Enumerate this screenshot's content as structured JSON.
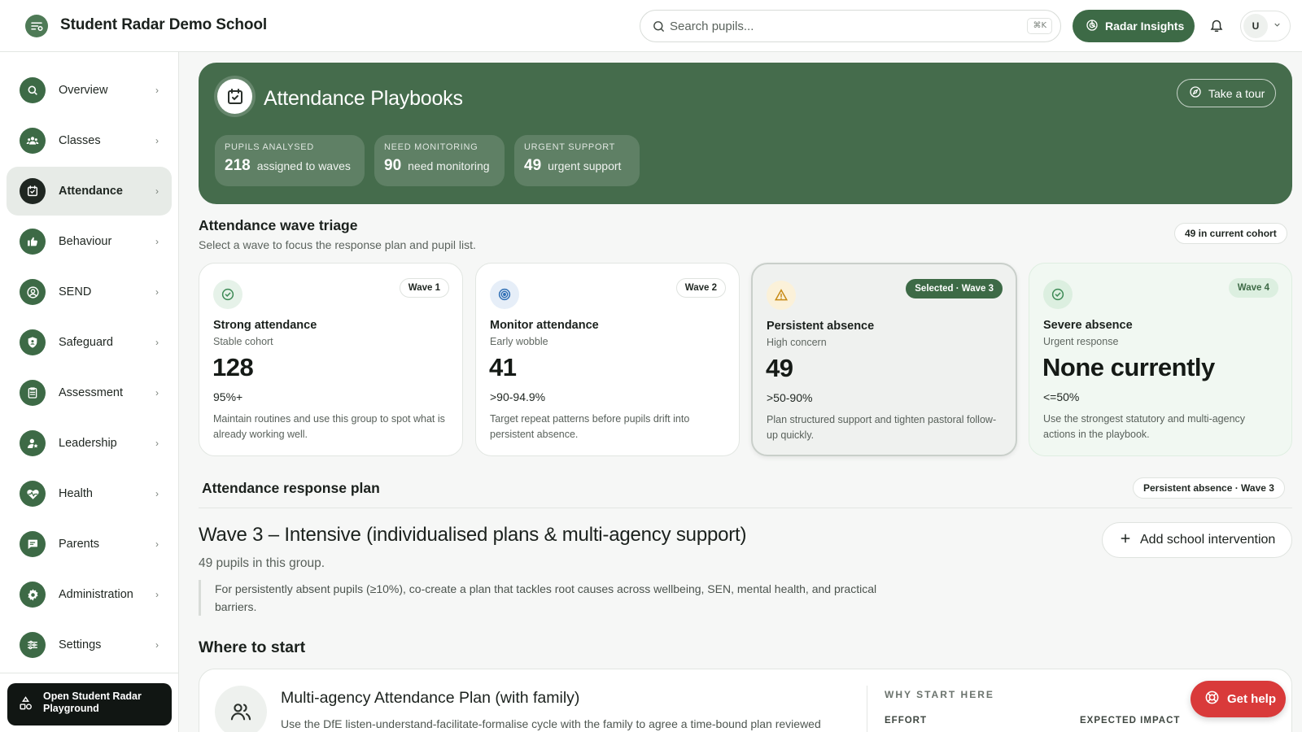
{
  "app": {
    "title": "Student Radar Demo School",
    "search_placeholder": "Search pupils...",
    "search_shortcut": "⌘K",
    "insights_label": "Radar Insights",
    "user_initial": "U"
  },
  "sidebar": {
    "items": [
      {
        "label": "Overview",
        "icon": "search-icon"
      },
      {
        "label": "Classes",
        "icon": "group-icon"
      },
      {
        "label": "Attendance",
        "icon": "calendar-check-icon",
        "active": true
      },
      {
        "label": "Behaviour",
        "icon": "thumbs-up-icon"
      },
      {
        "label": "SEND",
        "icon": "person-circle-icon"
      },
      {
        "label": "Safeguard",
        "icon": "shield-icon"
      },
      {
        "label": "Assessment",
        "icon": "clipboard-icon"
      },
      {
        "label": "Leadership",
        "icon": "person-star-icon"
      },
      {
        "label": "Health",
        "icon": "heart-pulse-icon"
      },
      {
        "label": "Parents",
        "icon": "chat-icon"
      },
      {
        "label": "Administration",
        "icon": "gear-icon"
      },
      {
        "label": "Settings",
        "icon": "sliders-icon"
      }
    ],
    "playground_label": "Open Student Radar Playground"
  },
  "hero": {
    "title": "Attendance Playbooks",
    "tour_label": "Take a tour",
    "stats": [
      {
        "label": "PUPILS ANALYSED",
        "value": "218",
        "desc": "assigned to waves"
      },
      {
        "label": "NEED MONITORING",
        "value": "90",
        "desc": "need monitoring"
      },
      {
        "label": "URGENT SUPPORT",
        "value": "49",
        "desc": "urgent support"
      }
    ]
  },
  "triage": {
    "title": "Attendance wave triage",
    "subtitle": "Select a wave to focus the response plan and pupil list.",
    "cohort_chip": "49 in current cohort",
    "waves": [
      {
        "tag": "Wave 1",
        "name": "Strong attendance",
        "sub": "Stable cohort",
        "count": "128",
        "range": "95%+",
        "desc": "Maintain routines and use this group to spot what is already working well.",
        "icon": "check-circle-icon",
        "color": "#3d8a55"
      },
      {
        "tag": "Wave 2",
        "name": "Monitor attendance",
        "sub": "Early wobble",
        "count": "41",
        "range": ">90-94.9%",
        "desc": "Target repeat patterns before pupils drift into persistent absence.",
        "icon": "target-icon",
        "color": "#2f6fb5"
      },
      {
        "tag": "Selected · Wave 3",
        "name": "Persistent absence",
        "sub": "High concern",
        "count": "49",
        "range": ">50-90%",
        "desc": "Plan structured support and tighten pastoral follow-up quickly.",
        "icon": "warning-icon",
        "color": "#c78a15"
      },
      {
        "tag": "Wave 4",
        "name": "Severe absence",
        "sub": "Urgent response",
        "count": "None currently",
        "range": "<=50%",
        "desc": "Use the strongest statutory and multi-agency actions in the playbook.",
        "icon": "check-circle-icon",
        "color": "#3d8a55"
      }
    ]
  },
  "plan": {
    "section_title": "Attendance response plan",
    "section_chip": "Persistent absence · Wave 3",
    "title": "Wave 3 – Intensive (individualised plans & multi-agency support)",
    "count_text": "49 pupils in this group.",
    "description": "For persistently absent pupils (≥10%), co-create a plan that tackles root causes across wellbeing, SEN, mental health, and practical barriers.",
    "add_label": "Add school intervention"
  },
  "start": {
    "title": "Where to start",
    "card_title": "Multi-agency Attendance Plan (with family)",
    "card_desc": "Use the DfE listen-understand-facilitate-formalise cycle with the family to agree a time-bound plan reviewed",
    "why_label": "WHY START HERE",
    "effort_label": "EFFORT",
    "impact_label": "EXPECTED IMPACT"
  },
  "help_label": "Get help",
  "colors": {
    "brand": "#3d6a46",
    "hero": "#456c4c",
    "help": "#d93a3a"
  }
}
